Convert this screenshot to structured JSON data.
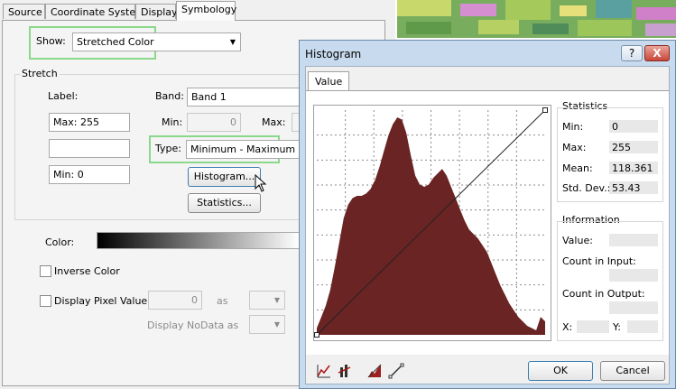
{
  "symbology": {
    "tabs": [
      "Source",
      "Coordinate System",
      "Display",
      "Symbology"
    ],
    "show_label": "Show:",
    "show_value": "Stretched Color",
    "stretch_group": "Stretch",
    "label_header": "Label:",
    "label_max": "Max: 255",
    "label_mid": "",
    "label_min": "Min: 0",
    "band_label": "Band:",
    "band_value": "Band 1",
    "min_label": "Min:",
    "min_value": "0",
    "max_label": "Max:",
    "type_label": "Type:",
    "type_value": "Minimum - Maximum",
    "histogram_button": "Histogram...",
    "statistics_button": "Statistics...",
    "color_label": "Color:",
    "inverse_color": "Inverse Color",
    "display_pixel_value": "Display Pixel Value",
    "pixel_value": "0",
    "as_label": "as",
    "nodata_label": "Display NoData as"
  },
  "histogram": {
    "title": "Histogram",
    "help": "?",
    "close": "X",
    "tab": "Value",
    "statistics_header": "Statistics",
    "stats": [
      {
        "label": "Min:",
        "value": "0"
      },
      {
        "label": "Max:",
        "value": "255"
      },
      {
        "label": "Mean:",
        "value": "118.361"
      },
      {
        "label": "Std. Dev.:",
        "value": "53.43"
      }
    ],
    "information_header": "Information",
    "info_value": "Value:",
    "info_count_input": "Count in Input:",
    "info_count_output": "Count in Output:",
    "info_x": "X:",
    "info_y": "Y:",
    "ok": "OK",
    "cancel": "Cancel",
    "toolbar_icons": [
      "chart-line-icon",
      "chart-bars-icon",
      "stretch-curve-icon",
      "diagonal-line-icon"
    ],
    "fill_color": "#6b2424"
  },
  "chart_data": {
    "type": "area",
    "x": [
      0,
      5,
      10,
      15,
      20,
      25,
      30,
      35,
      40,
      45,
      50,
      55,
      60,
      65,
      70,
      75,
      80,
      85,
      90,
      95,
      100,
      105,
      110,
      115,
      120,
      125,
      130,
      135,
      140,
      145,
      150,
      155,
      160,
      165,
      170,
      175,
      180,
      185,
      190,
      195,
      200,
      205,
      210,
      215,
      220,
      225,
      230,
      235,
      240,
      245,
      250,
      255
    ],
    "values": [
      3,
      8,
      13,
      20,
      30,
      41,
      52,
      58,
      61,
      62,
      62,
      63,
      65,
      69,
      75,
      82,
      89,
      94,
      97,
      96,
      90,
      80,
      71,
      67,
      66,
      67,
      70,
      72,
      74,
      71,
      66,
      61,
      56,
      51,
      47,
      45,
      43,
      40,
      37,
      32,
      27,
      22,
      18,
      14,
      11,
      8,
      6,
      4,
      3,
      2,
      8,
      6
    ],
    "xlim": [
      0,
      255
    ],
    "grid": true
  }
}
